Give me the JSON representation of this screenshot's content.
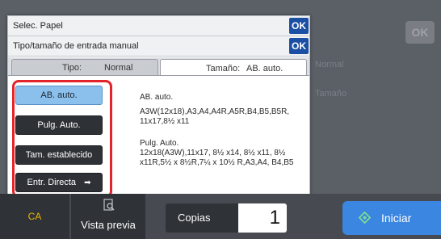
{
  "dialog": {
    "title": "Selec. Papel",
    "subtitle": "Tipo/tamaño de entrada manual",
    "ok_label": "OK",
    "ok2_label": "OK"
  },
  "tabs": {
    "tipo_label": "Tipo:",
    "tipo_value": "Normal",
    "size_label": "Tamaño:",
    "size_value": "AB. auto."
  },
  "buttons": {
    "ab_auto": "AB. auto.",
    "pulg_auto": "Pulg. Auto.",
    "tam_establecido": "Tam. establecido",
    "entr_directa": "Entr. Directa"
  },
  "info": {
    "ab_title": "AB. auto.",
    "ab_sizes": "A3W(12x18),A3,A4,A4R,A5R,B4,B5,B5R, 11x17,8½ x11",
    "pulg_title": "Pulg. Auto.",
    "pulg_sizes": "12x18(A3W),11x17, 8½ x14, 8½ x11, 8½ x11R,5½ x 8½R,7¼ x 10½ R,A3,A4, B4,B5"
  },
  "background": {
    "ok_label": "OK",
    "ghost_normal": "Normal",
    "ghost_tamano": "Tamaño"
  },
  "bottom": {
    "ca_label": "CA",
    "preview_label": "Vista previa",
    "copias_label": "Copias",
    "copias_value": "1",
    "start_label": "Iniciar"
  },
  "colors": {
    "accent_blue": "#1a4fa3",
    "start_blue": "#3a86e0",
    "highlight_red": "#e3242b",
    "selected_button": "#8cc0ec",
    "ca_text": "#f0b400"
  }
}
